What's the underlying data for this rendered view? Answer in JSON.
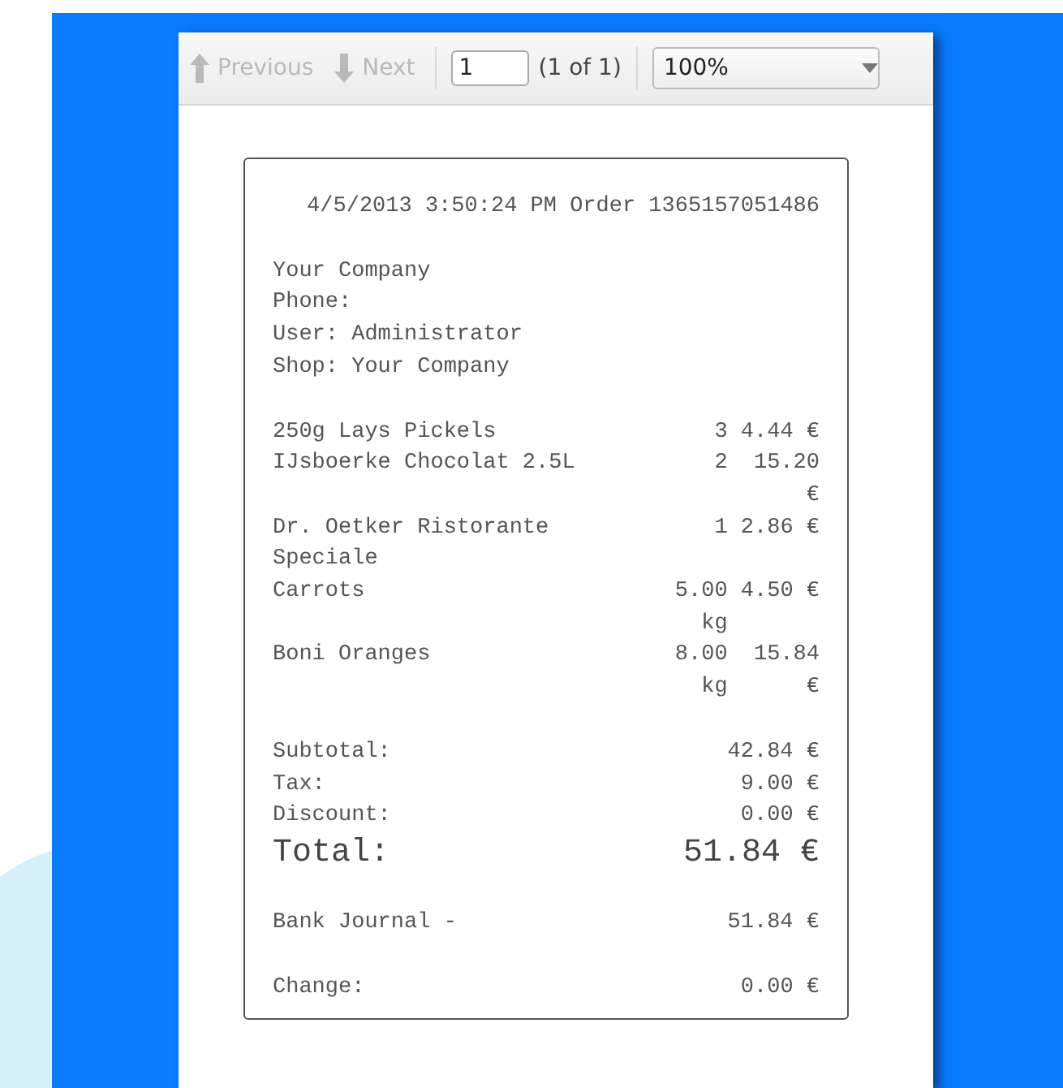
{
  "toolbar": {
    "previous": {
      "label": "Previous",
      "disabled": true
    },
    "next": {
      "label": "Next",
      "disabled": true
    },
    "page_input": {
      "value": "1"
    },
    "page_count": "(1 of 1)",
    "zoom": {
      "value": "100%"
    }
  },
  "receipt": {
    "header": "4/5/2013 3:50:24 PM Order 1365157051486",
    "info_lines": [
      "Your Company",
      "Phone:",
      "User: Administrator",
      "Shop: Your Company"
    ],
    "items": [
      {
        "name": "250g Lays Pickels",
        "quantity": "3",
        "price": "4.44 €"
      },
      {
        "name": "IJsboerke Chocolat 2.5L",
        "quantity": "2",
        "price": "15.20 €"
      },
      {
        "name": "Dr. Oetker Ristorante Speciale",
        "quantity": "1",
        "price": "2.86 €"
      },
      {
        "name": "Carrots",
        "quantity": "5.00 kg",
        "price": "4.50 €"
      },
      {
        "name": "Boni Oranges",
        "quantity": "8.00 kg",
        "price": "15.84 €"
      }
    ],
    "totals": [
      {
        "kind": "normal",
        "label": "Subtotal:",
        "value": "42.84 €"
      },
      {
        "kind": "normal",
        "label": "Tax:",
        "value": "9.00 €"
      },
      {
        "kind": "normal",
        "label": "Discount:",
        "value": "0.00 €"
      },
      {
        "kind": "grand",
        "label": "Total:",
        "value": "51.84 €"
      }
    ],
    "payments": [
      {
        "label": "Bank Journal -",
        "value": "51.84 €"
      }
    ],
    "change": {
      "label": "Change:",
      "value": "0.00 €"
    }
  }
}
